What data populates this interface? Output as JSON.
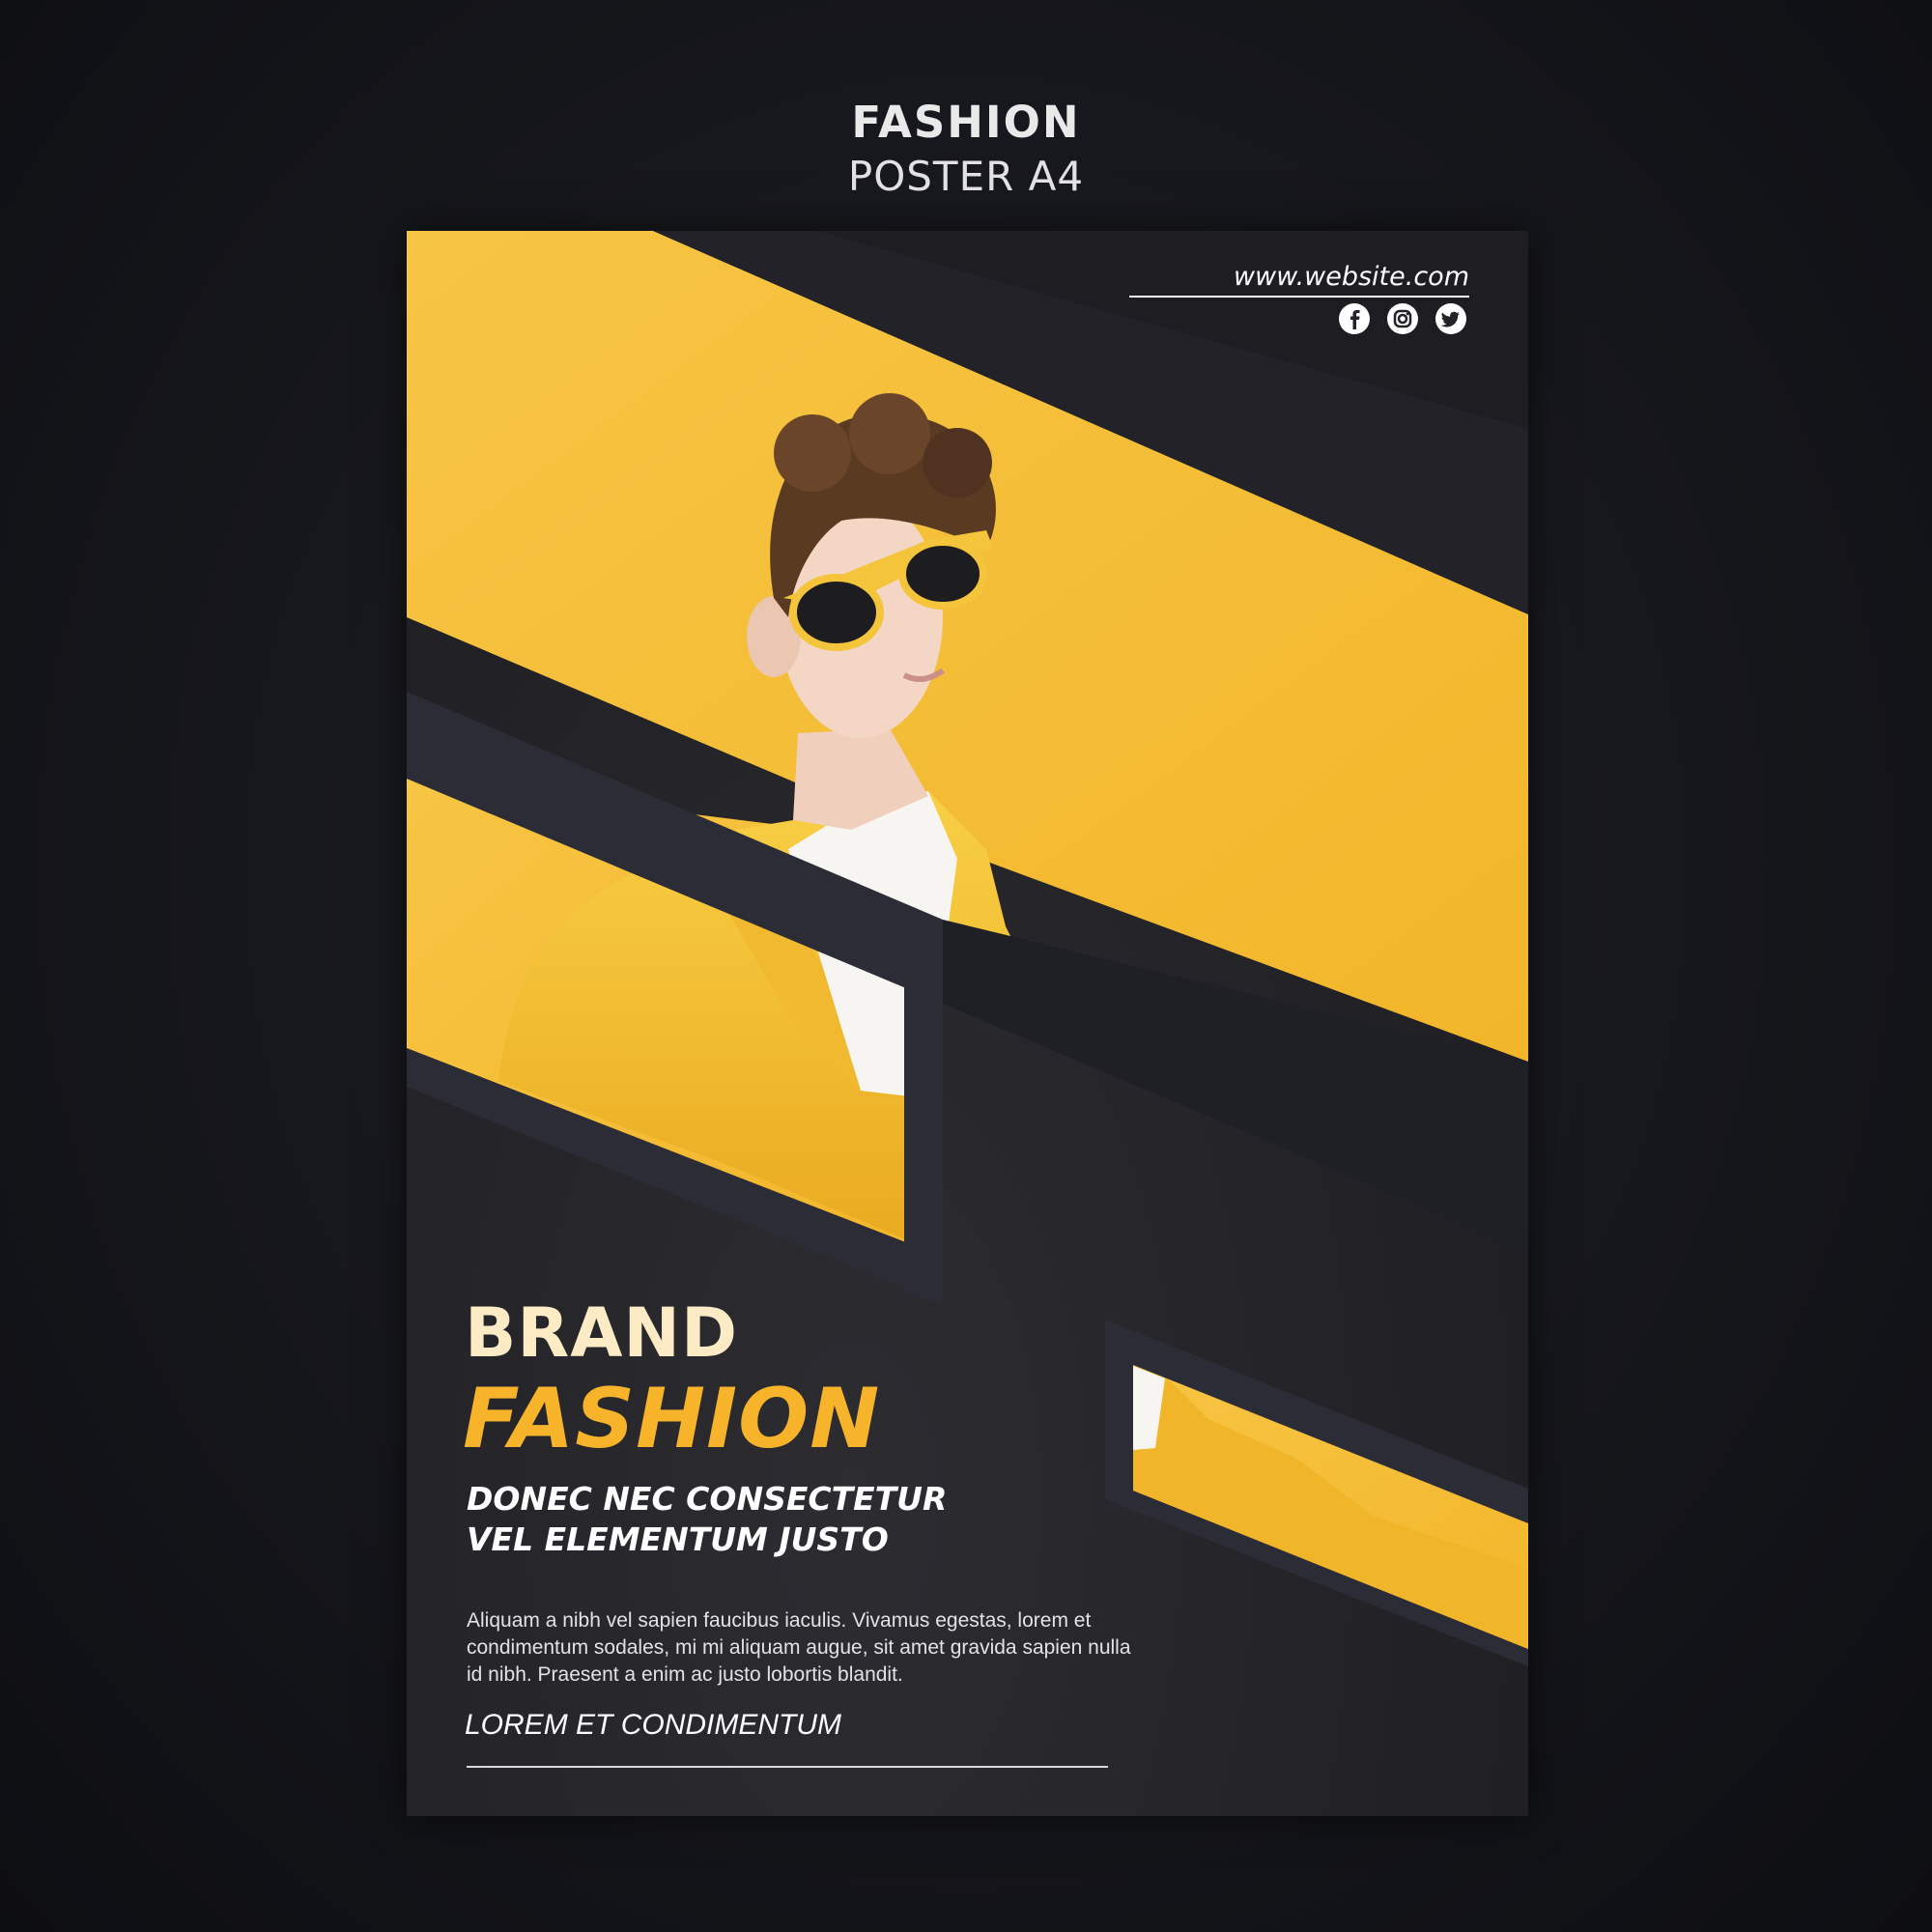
{
  "header": {
    "title": "FASHION",
    "subtitle": "POSTER A4"
  },
  "poster": {
    "website": "www.website.com",
    "social_icons": [
      "facebook-icon",
      "instagram-icon",
      "twitter-icon"
    ],
    "brand": "BRAND",
    "headline": "FASHION",
    "tagline_lines": [
      "DONEC NEC CONSECTETUR",
      "VEL ELEMENTUM JUSTO"
    ],
    "body_text": "Aliquam a nibh vel sapien faucibus iaculis. Vivamus egestas, lorem et condimentum sodales, mi mi aliquam augue, sit amet gravida sapien nulla id nibh. Praesent a enim ac justo lobortis blandit.",
    "footer": "LOREM ET CONDIMENTUM"
  },
  "colors": {
    "accent_yellow": "#f7b42b",
    "photo_yellow": "#f6c23c",
    "dark_band": "#2a2a33",
    "background": "#15161b"
  }
}
